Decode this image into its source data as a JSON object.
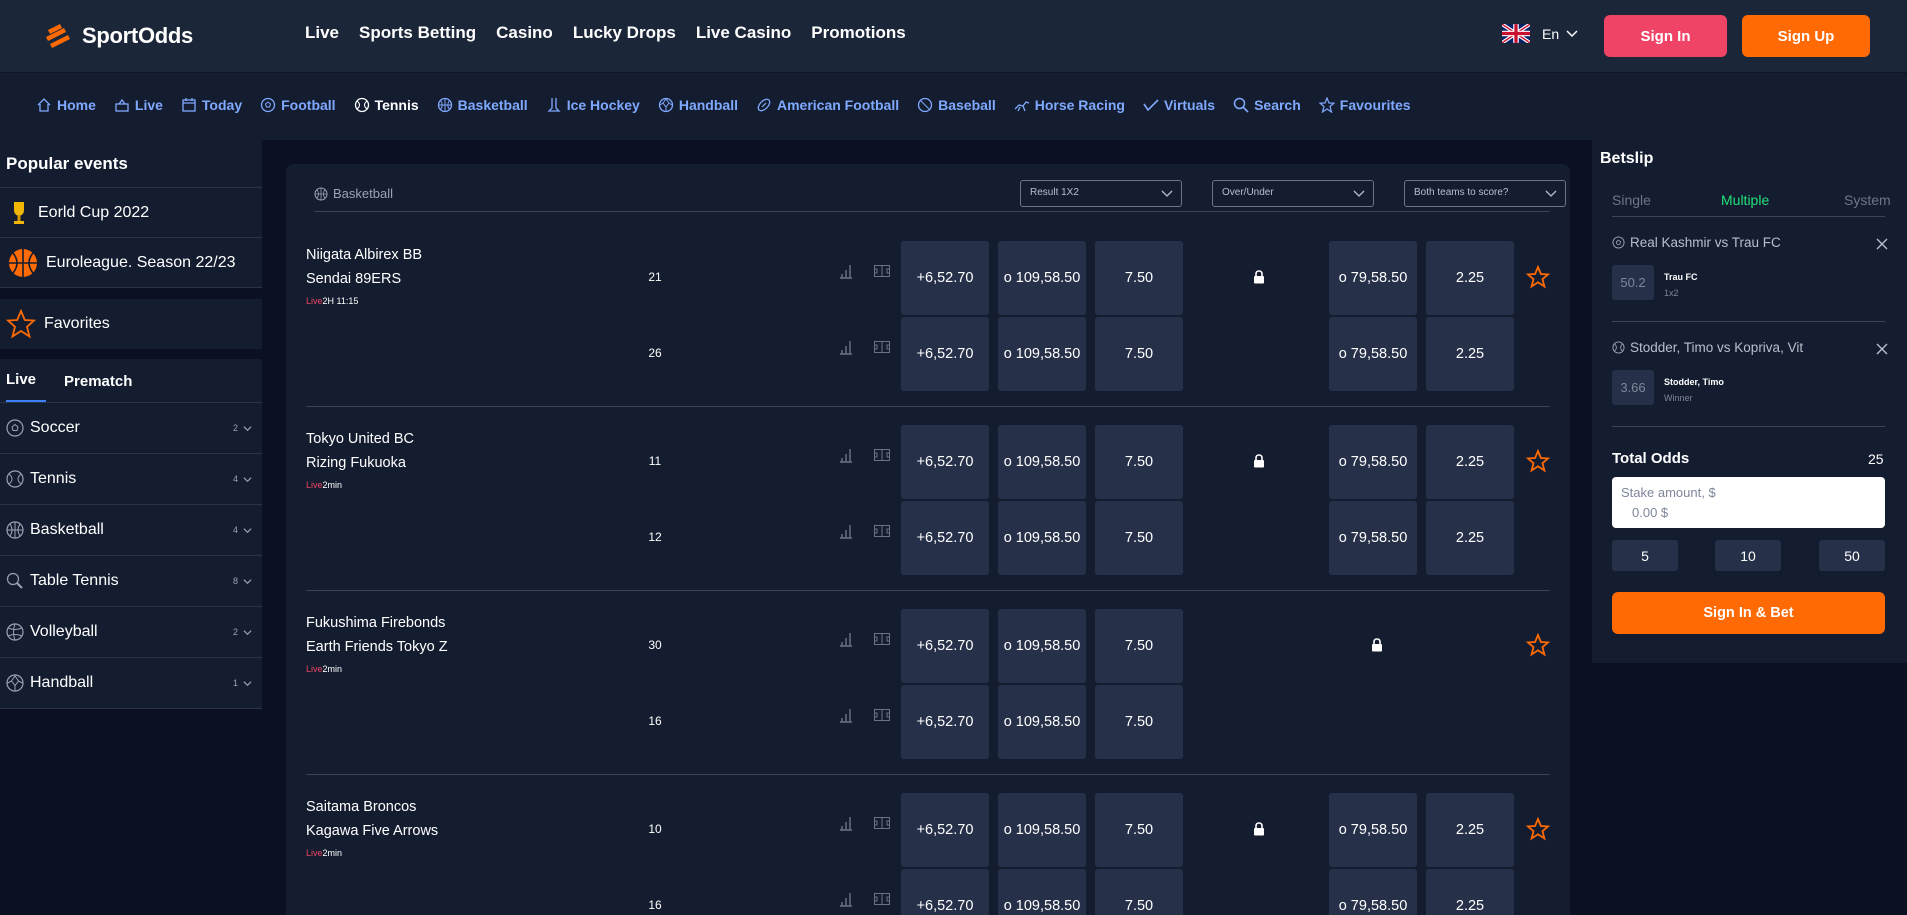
{
  "header": {
    "brand": "SportOdds",
    "nav": [
      "Live",
      "Sports Betting",
      "Casino",
      "Lucky Drops",
      "Live Casino",
      "Promotions"
    ],
    "language": "En",
    "signin_label": "Sign In",
    "signup_label": "Sign Up"
  },
  "subnav": [
    {
      "label": "Home",
      "icon": "home-icon"
    },
    {
      "label": "Live",
      "icon": "live-icon"
    },
    {
      "label": "Today",
      "icon": "calendar-icon"
    },
    {
      "label": "Football",
      "icon": "football-icon"
    },
    {
      "label": "Tennis",
      "icon": "tennis-icon",
      "active": true
    },
    {
      "label": "Basketball",
      "icon": "basketball-icon"
    },
    {
      "label": "Ice Hockey",
      "icon": "ice-hockey-icon"
    },
    {
      "label": "Handball",
      "icon": "handball-icon"
    },
    {
      "label": "American Football",
      "icon": "american-football-icon"
    },
    {
      "label": "Baseball",
      "icon": "baseball-icon"
    },
    {
      "label": "Horse Racing",
      "icon": "horse-racing-icon"
    },
    {
      "label": "Virtuals",
      "icon": "virtuals-icon"
    },
    {
      "label": "Search",
      "icon": "search-icon"
    },
    {
      "label": "Favourites",
      "icon": "star-icon"
    }
  ],
  "sidebar": {
    "popular_title": "Popular events",
    "popular": [
      "Eorld Cup 2022",
      "Euroleague. Season 22/23"
    ],
    "favorites": "Favorites",
    "tabs": [
      "Live",
      "Prematch"
    ],
    "sports": [
      {
        "name": "Soccer",
        "count": "2"
      },
      {
        "name": "Tennis",
        "count": "4"
      },
      {
        "name": "Basketball",
        "count": "4"
      },
      {
        "name": "Table Tennis",
        "count": "8"
      },
      {
        "name": "Volleyball",
        "count": "2"
      },
      {
        "name": "Handball",
        "count": "1"
      }
    ]
  },
  "main": {
    "sport": "Basketball",
    "selectors": [
      "Result 1X2",
      "Over/Under",
      "Both teams to score?"
    ],
    "events": [
      {
        "team1": "Niigata Albirex BB",
        "team2": "Sendai 89ERS",
        "live": "Live",
        "time": "2H 11:15",
        "rows": [
          {
            "score": "21",
            "odds": [
              "+6,52.70",
              "o 109,58.50",
              "7.50",
              "o 79,58.50",
              "2.25"
            ]
          },
          {
            "score": "26",
            "odds": [
              "+6,52.70",
              "o 109,58.50",
              "7.50",
              "o 79,58.50",
              "2.25"
            ]
          }
        ]
      },
      {
        "team1": "Tokyo United BC",
        "team2": "Rizing Fukuoka",
        "live": "Live",
        "time": "2min",
        "rows": [
          {
            "score": "11",
            "odds": [
              "+6,52.70",
              "o 109,58.50",
              "7.50",
              "o 79,58.50",
              "2.25"
            ]
          },
          {
            "score": "12",
            "odds": [
              "+6,52.70",
              "o 109,58.50",
              "7.50",
              "o 79,58.50",
              "2.25"
            ]
          }
        ]
      },
      {
        "team1": "Fukushima Firebonds",
        "team2": "Earth Friends Tokyo Z",
        "live": "Live",
        "time": "2min",
        "rows": [
          {
            "score": "30",
            "odds": [
              "+6,52.70",
              "o 109,58.50",
              "7.50"
            ]
          },
          {
            "score": "16",
            "odds": [
              "+6,52.70",
              "o 109,58.50",
              "7.50"
            ]
          }
        ]
      },
      {
        "team1": "Saitama Broncos",
        "team2": "Kagawa Five Arrows",
        "live": "Live",
        "time": "2min",
        "rows": [
          {
            "score": "10",
            "odds": [
              "+6,52.70",
              "o 109,58.50",
              "7.50",
              "o 79,58.50",
              "2.25"
            ]
          },
          {
            "score": "16",
            "odds": [
              "+6,52.70",
              "o 109,58.50",
              "7.50",
              "o 79,58.50",
              "2.25"
            ]
          }
        ]
      }
    ]
  },
  "betslip": {
    "title": "Betslip",
    "tabs": [
      "Single",
      "Multiple",
      "System"
    ],
    "active_tab": "Multiple",
    "bets": [
      {
        "match": "Real Kashmir vs Trau FC",
        "odd": "50.2",
        "pick": "Trau FC",
        "market": "1x2"
      },
      {
        "match": "Stodder, Timo vs Kopriva, Vit",
        "odd": "3.66",
        "pick": "Stodder, Timo",
        "market": "Winner"
      }
    ],
    "total_label": "Total Odds",
    "total_value": "25",
    "stake_placeholder": "Stake amount, $",
    "stake_value": "0.00 $",
    "quick": [
      "5",
      "10",
      "50"
    ],
    "button": "Sign In & Bet"
  },
  "colors": {
    "background": "#0b1122",
    "panel": "#141d2f",
    "odd_cell": "#263149",
    "accent_orange": "#ff6a05",
    "accent_pink": "#ef4466",
    "link_blue": "#7fa9ff",
    "active_green": "#22e07a"
  }
}
